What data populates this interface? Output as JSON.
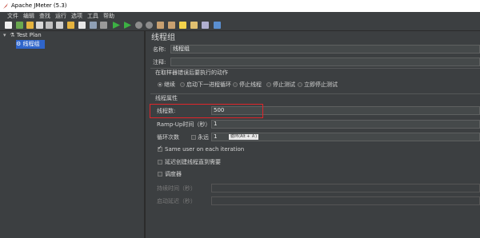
{
  "window": {
    "title": "Apache JMeter (5.3)"
  },
  "menu": [
    "文件",
    "编辑",
    "查找",
    "运行",
    "选项",
    "工具",
    "帮助"
  ],
  "toolbar": {
    "icons": [
      "new-icon",
      "templates-icon",
      "open-icon",
      "save-icon",
      "cut-icon",
      "copy-icon",
      "paste-icon",
      "expand-icon",
      "collapse-icon",
      "toggle-icon",
      "start-icon",
      "start-no-pause-icon",
      "stop-icon",
      "shutdown-icon",
      "clear-icon",
      "clear-all-icon",
      "search-icon",
      "reset-search-icon",
      "function-helper-icon",
      "help-icon"
    ]
  },
  "tree": {
    "items": [
      {
        "label": "Test Plan",
        "selected": false
      },
      {
        "label": "线程组",
        "selected": true
      }
    ]
  },
  "panel": {
    "title": "线程组",
    "name_label": "名称:",
    "name_value": "线程组",
    "comment_label": "注释:",
    "comment_value": "",
    "error_action_label": "在取样器错误后要执行的动作",
    "error_actions": [
      {
        "label": "继续",
        "selected": true
      },
      {
        "label": "启动下一进程循环",
        "selected": false
      },
      {
        "label": "停止线程",
        "selected": false
      },
      {
        "label": "停止测试",
        "selected": false
      },
      {
        "label": "立即停止测试",
        "selected": false
      }
    ],
    "thread_props_label": "线程属性",
    "threads_label": "线程数:",
    "threads_value": "500",
    "rampup_label": "Ramp-Up时间（秒）:",
    "rampup_value": "1",
    "loop_label": "循环次数",
    "loop_forever_label": "永远",
    "loop_value": "1",
    "loop_tooltip": "循环(Alt + Ａ)",
    "same_user_label": "Same user on each iteration",
    "same_user_checked": true,
    "delay_create_label": "延迟创建线程直到需要",
    "delay_create_checked": false,
    "scheduler_label": "调度器",
    "scheduler_checked": false,
    "duration_label": "持续时间（秒）",
    "startup_delay_label": "启动延迟（秒）"
  },
  "colors": {
    "highlight": "#e0252a",
    "selection": "#2f65ca",
    "background": "#3c3f41"
  }
}
